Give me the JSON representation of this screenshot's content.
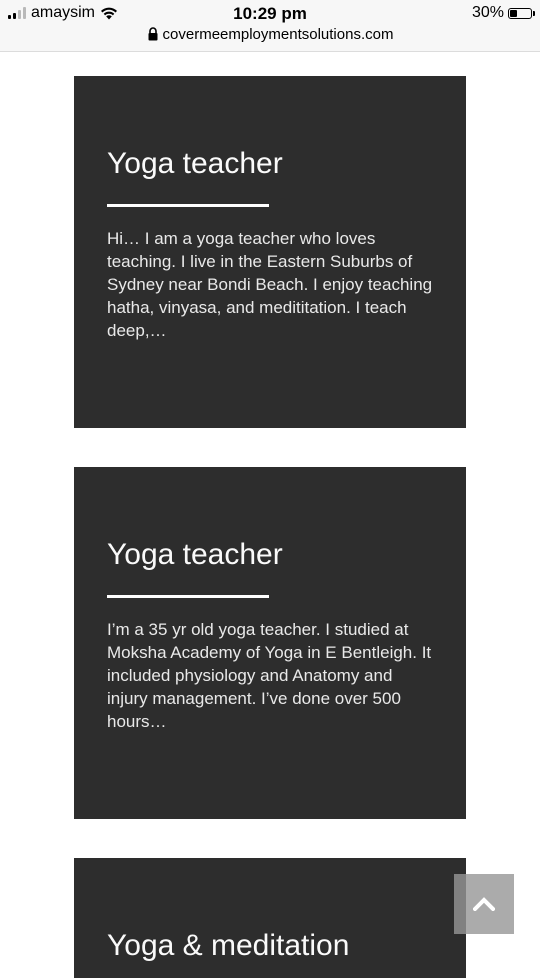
{
  "status_bar": {
    "carrier": "amaysim",
    "time": "10:29 pm",
    "battery": "30%",
    "battery_level": 0.3,
    "url": "covermeemploymentsolutions.com"
  },
  "cards": [
    {
      "title": "Yoga teacher",
      "excerpt": "Hi… I am a yoga teacher who loves teaching. I live in the Eastern Suburbs of Sydney near Bondi Beach. I enjoy teaching  hatha, vinyasa, and medititation. I teach deep,…"
    },
    {
      "title": "Yoga teacher",
      "excerpt": "I’m a 35 yr old yoga teacher. I studied at Moksha Academy of Yoga in E Bentleigh. It included physiology and Anatomy and injury management. I’ve done over 500 hours…"
    },
    {
      "title": "Yoga & meditation"
    }
  ],
  "icons": {
    "signal": "cellular-signal-icon",
    "wifi": "wifi-icon",
    "battery": "battery-icon",
    "lock": "lock-icon",
    "back_to_top": "chevron-up-icon"
  }
}
